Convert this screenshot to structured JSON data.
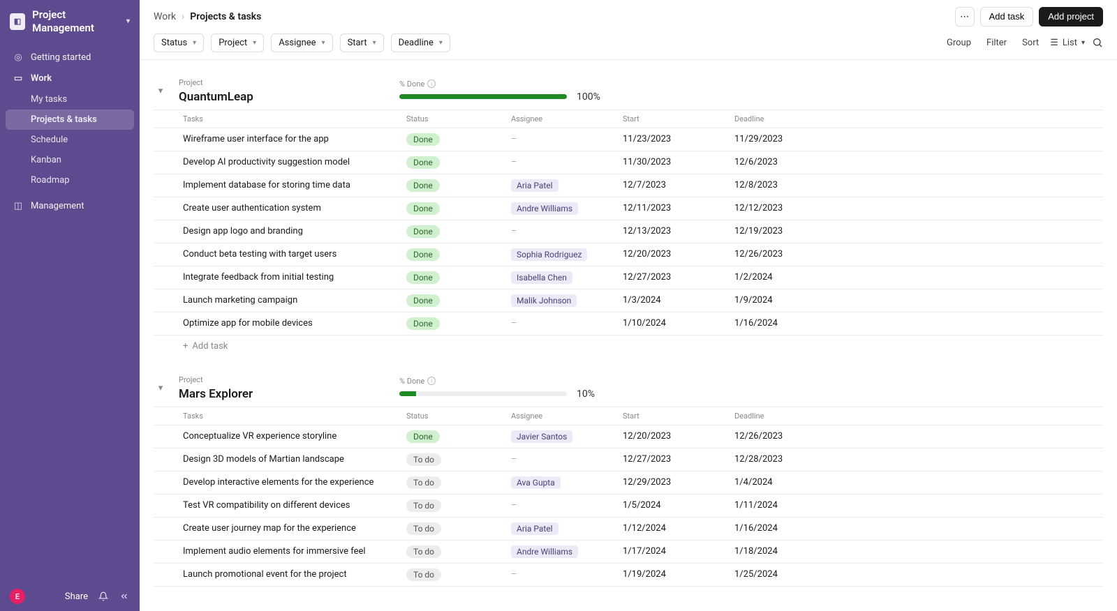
{
  "app": {
    "title": "Project Management"
  },
  "sidebar": {
    "items": [
      {
        "label": "Getting started"
      },
      {
        "label": "Work"
      }
    ],
    "work_sub": [
      {
        "label": "My tasks"
      },
      {
        "label": "Projects & tasks"
      },
      {
        "label": "Schedule"
      },
      {
        "label": "Kanban"
      },
      {
        "label": "Roadmap"
      }
    ],
    "bottom_items": [
      {
        "label": "Management"
      }
    ],
    "footer": {
      "avatar_letter": "E",
      "share": "Share"
    }
  },
  "breadcrumb": {
    "root": "Work",
    "current": "Projects & tasks"
  },
  "topbar": {
    "more": "...",
    "add_task": "Add task",
    "add_project": "Add project"
  },
  "filters": {
    "pills": [
      "Status",
      "Project",
      "Assignee",
      "Start",
      "Deadline"
    ],
    "right": {
      "group": "Group",
      "filter": "Filter",
      "sort": "Sort",
      "view": "List"
    }
  },
  "labels": {
    "project": "Project",
    "pct_done": "% Done",
    "tasks": "Tasks",
    "status": "Status",
    "assignee": "Assignee",
    "start": "Start",
    "deadline": "Deadline",
    "add_task": "Add task"
  },
  "groups": [
    {
      "name": "QuantumLeap",
      "pct": 100,
      "pct_text": "100%",
      "tasks": [
        {
          "name": "Wireframe user interface for the app",
          "status": "Done",
          "assignee": "",
          "start": "11/23/2023",
          "deadline": "11/29/2023"
        },
        {
          "name": "Develop AI productivity suggestion model",
          "status": "Done",
          "assignee": "",
          "start": "11/30/2023",
          "deadline": "12/6/2023"
        },
        {
          "name": "Implement database for storing time data",
          "status": "Done",
          "assignee": "Aria Patel",
          "start": "12/7/2023",
          "deadline": "12/8/2023"
        },
        {
          "name": "Create user authentication system",
          "status": "Done",
          "assignee": "Andre Williams",
          "start": "12/11/2023",
          "deadline": "12/12/2023"
        },
        {
          "name": "Design app logo and branding",
          "status": "Done",
          "assignee": "",
          "start": "12/13/2023",
          "deadline": "12/19/2023"
        },
        {
          "name": "Conduct beta testing with target users",
          "status": "Done",
          "assignee": "Sophia Rodriguez",
          "start": "12/20/2023",
          "deadline": "12/26/2023"
        },
        {
          "name": "Integrate feedback from initial testing",
          "status": "Done",
          "assignee": "Isabella Chen",
          "start": "12/27/2023",
          "deadline": "1/2/2024"
        },
        {
          "name": "Launch marketing campaign",
          "status": "Done",
          "assignee": "Malik Johnson",
          "start": "1/3/2024",
          "deadline": "1/9/2024"
        },
        {
          "name": "Optimize app for mobile devices",
          "status": "Done",
          "assignee": "",
          "start": "1/10/2024",
          "deadline": "1/16/2024"
        }
      ]
    },
    {
      "name": "Mars Explorer",
      "pct": 10,
      "pct_text": "10%",
      "tasks": [
        {
          "name": "Conceptualize VR experience storyline",
          "status": "Done",
          "assignee": "Javier Santos",
          "start": "12/20/2023",
          "deadline": "12/26/2023"
        },
        {
          "name": "Design 3D models of Martian landscape",
          "status": "To do",
          "assignee": "",
          "start": "12/27/2023",
          "deadline": "12/28/2023"
        },
        {
          "name": "Develop interactive elements for the experience",
          "status": "To do",
          "assignee": "Ava Gupta",
          "start": "12/29/2023",
          "deadline": "1/4/2024"
        },
        {
          "name": "Test VR compatibility on different devices",
          "status": "To do",
          "assignee": "",
          "start": "1/5/2024",
          "deadline": "1/11/2024"
        },
        {
          "name": "Create user journey map for the experience",
          "status": "To do",
          "assignee": "Aria Patel",
          "start": "1/12/2024",
          "deadline": "1/16/2024"
        },
        {
          "name": "Implement audio elements for immersive feel",
          "status": "To do",
          "assignee": "Andre Williams",
          "start": "1/17/2024",
          "deadline": "1/18/2024"
        },
        {
          "name": "Launch promotional event for the project",
          "status": "To do",
          "assignee": "",
          "start": "1/19/2024",
          "deadline": "1/25/2024"
        }
      ]
    }
  ]
}
